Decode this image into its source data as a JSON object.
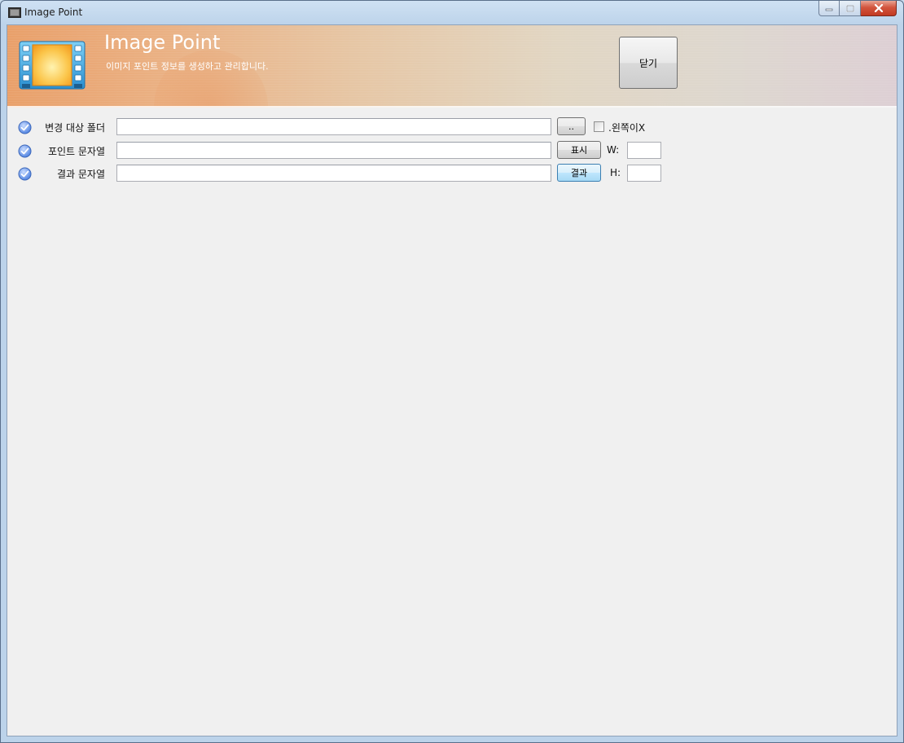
{
  "window": {
    "title": "Image Point"
  },
  "header": {
    "title": "Image Point",
    "subtitle": "이미지 포인트 정보를 생성하고 관리합니다.",
    "close_label": "닫기"
  },
  "form": {
    "rows": [
      {
        "label": "변경 대상 폴더",
        "value": "",
        "button_label": ".."
      },
      {
        "label": "포인트 문자열",
        "value": "",
        "button_label": "표시"
      },
      {
        "label": "결과 문자열",
        "value": "",
        "button_label": "결과"
      }
    ],
    "checkbox_label": ".왼쪽이X",
    "checkbox_checked": false,
    "width_label": "W:",
    "width_value": "",
    "height_label": "H:",
    "height_value": ""
  },
  "colors": {
    "header_start": "#e9a06a",
    "header_end": "#ddcfd4",
    "client_bg": "#f0f0f0",
    "check_icon": "#5b8ee6"
  },
  "icons": {
    "app": "film-icon",
    "row_marker": "check-circle-icon"
  }
}
